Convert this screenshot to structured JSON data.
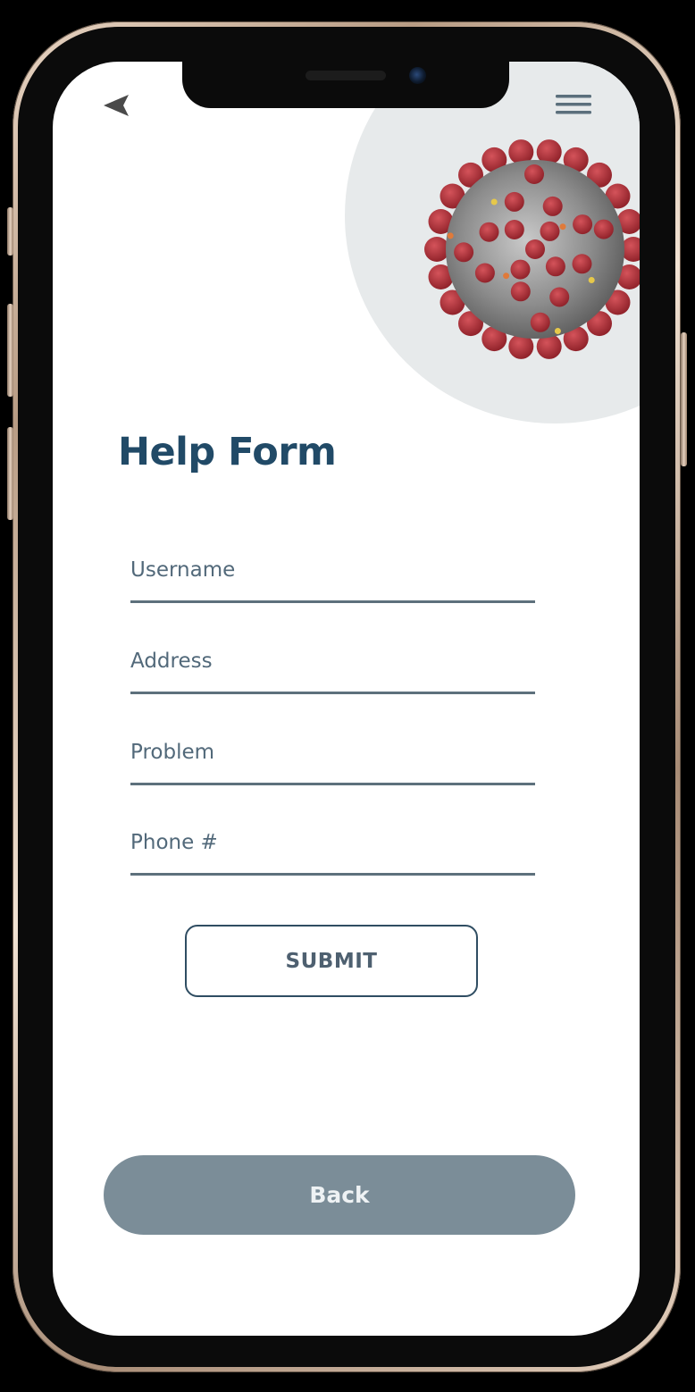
{
  "header": {
    "back_icon": "chevron-left-icon",
    "menu_icon": "hamburger-menu-icon"
  },
  "hero": {
    "image": "coronavirus-illustration"
  },
  "form": {
    "title": "Help Form",
    "fields": [
      {
        "placeholder": "Username",
        "value": ""
      },
      {
        "placeholder": "Address",
        "value": ""
      },
      {
        "placeholder": "Problem",
        "value": ""
      },
      {
        "placeholder": "Phone #",
        "value": ""
      }
    ],
    "submit_label": "SUBMIT"
  },
  "footer": {
    "back_label": "Back"
  },
  "colors": {
    "title": "#214a67",
    "back_button": "#7b8d98",
    "field_underline": "#5d707c",
    "hero_circle": "#e7eaeb",
    "virus_spikes": "#b8333a"
  }
}
